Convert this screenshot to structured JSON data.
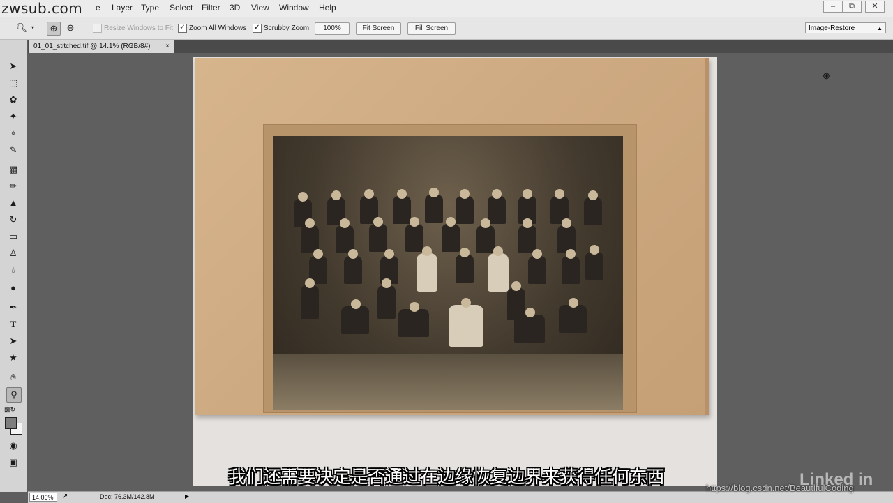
{
  "watermark_top": "zwsub.com",
  "menu": [
    "Layer",
    "Type",
    "Select",
    "Filter",
    "3D",
    "View",
    "Window",
    "Help"
  ],
  "menu_partial": "e",
  "window_controls": [
    "–",
    "⧉",
    "✕"
  ],
  "options": {
    "resize_windows": "Resize Windows to Fit",
    "zoom_all": "Zoom All Windows",
    "scrubby_zoom": "Scrubby Zoom",
    "pct_btn": "100%",
    "fit_screen": "Fit Screen",
    "fill_screen": "Fill Screen",
    "workspace": "Image-Restore",
    "check_mark": "✓"
  },
  "document": {
    "tab_title": "01_01_stitched.tif @ 14.1% (RGB/8#)",
    "tab_close": "×"
  },
  "status": {
    "zoom": "14.06%",
    "doc": "Doc: 76.3M/142.8M",
    "arrow": "▶"
  },
  "subtitle": "我们还需要决定是否通过在边缘恢复边界来获得任何东西",
  "blog_watermark": "https://blog.csdn.net/BeautifulCoding",
  "linkedin": "Linked in"
}
